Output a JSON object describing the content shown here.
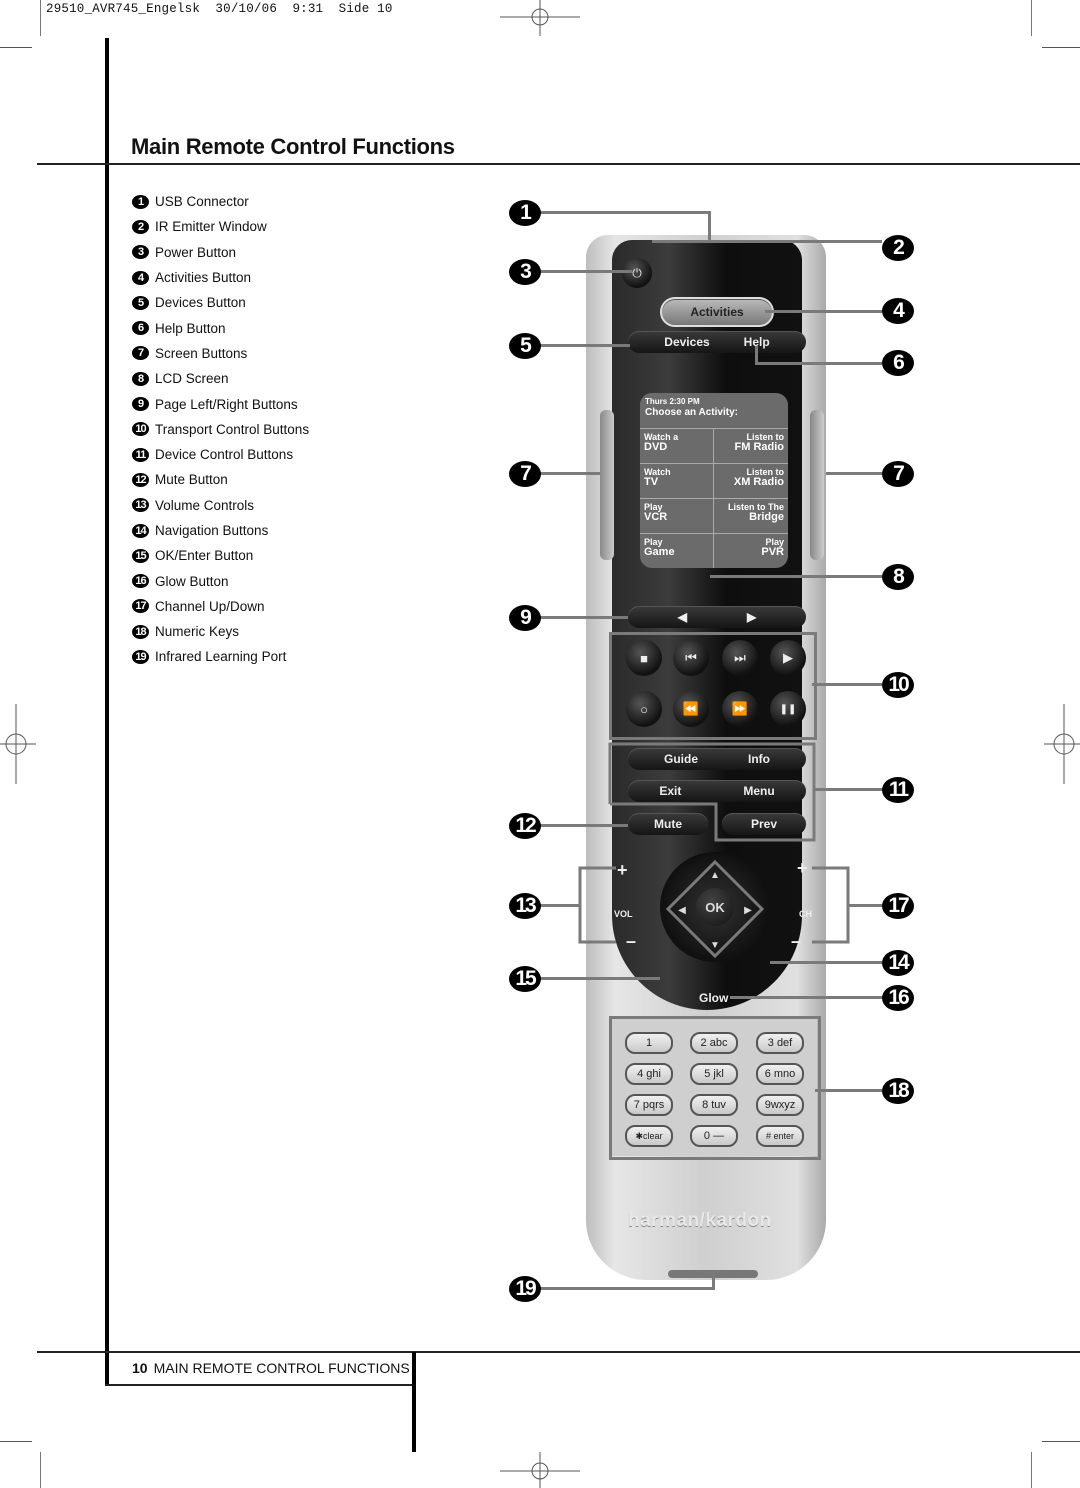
{
  "slug": "29510_AVR745_Engelsk  30/10/06  9:31  Side 10",
  "page_title": "Main Remote Control Functions",
  "legend": [
    {
      "num": "1",
      "label": "USB Connector"
    },
    {
      "num": "2",
      "label": "IR Emitter Window"
    },
    {
      "num": "3",
      "label": "Power Button"
    },
    {
      "num": "4",
      "label": "Activities Button"
    },
    {
      "num": "5",
      "label": "Devices Button"
    },
    {
      "num": "6",
      "label": "Help Button"
    },
    {
      "num": "7",
      "label": "Screen Buttons"
    },
    {
      "num": "8",
      "label": "LCD Screen"
    },
    {
      "num": "9",
      "label": "Page Left/Right Buttons"
    },
    {
      "num": "10",
      "label": "Transport Control Buttons"
    },
    {
      "num": "11",
      "label": "Device Control Buttons"
    },
    {
      "num": "12",
      "label": "Mute Button"
    },
    {
      "num": "13",
      "label": "Volume Controls"
    },
    {
      "num": "14",
      "label": "Navigation Buttons"
    },
    {
      "num": "15",
      "label": "OK/Enter Button"
    },
    {
      "num": "16",
      "label": "Glow Button"
    },
    {
      "num": "17",
      "label": "Channel Up/Down"
    },
    {
      "num": "18",
      "label": "Numeric Keys"
    },
    {
      "num": "19",
      "label": "Infrared Learning Port"
    }
  ],
  "callouts": {
    "c1": "1",
    "c2": "2",
    "c3": "3",
    "c4": "4",
    "c5": "5",
    "c6": "6",
    "c7a": "7",
    "c7b": "7",
    "c8": "8",
    "c9": "9",
    "c10": "10",
    "c11": "11",
    "c12": "12",
    "c13": "13",
    "c14": "14",
    "c15": "15",
    "c16": "16",
    "c17": "17",
    "c18": "18",
    "c19": "19"
  },
  "remote": {
    "power_icon": "power-icon",
    "activities": "Activities",
    "devices": "Devices",
    "help": "Help",
    "lcd": {
      "time": "Thurs 2:30 PM",
      "heading": "Choose an Activity:",
      "cells": [
        {
          "line1": "Watch a",
          "line2": "DVD"
        },
        {
          "line1": "Listen to",
          "line2": "FM Radio"
        },
        {
          "line1": "Watch",
          "line2": "TV"
        },
        {
          "line1": "Listen to",
          "line2": "XM Radio"
        },
        {
          "line1": "Play",
          "line2": "VCR"
        },
        {
          "line1": "Listen to The",
          "line2": "Bridge"
        },
        {
          "line1": "Play",
          "line2": "Game"
        },
        {
          "line1": "Play",
          "line2": "PVR"
        }
      ]
    },
    "page_left": "◀",
    "page_right": "▶",
    "transport": [
      "■",
      "⏮",
      "⏭",
      "▶",
      "○",
      "⏪",
      "⏩",
      "❚❚"
    ],
    "guide": "Guide",
    "info": "Info",
    "exit": "Exit",
    "menu": "Menu",
    "mute": "Mute",
    "prev": "Prev",
    "vol_label": "VOL",
    "ch_label": "CH",
    "plus": "+",
    "minus": "–",
    "ok": "OK",
    "glow": "Glow",
    "keys": [
      "1",
      "2 abc",
      "3 def",
      "4 ghi",
      "5 jkl",
      "6 mno",
      "7 pqrs",
      "8 tuv",
      "9wxyz",
      "✱clear",
      "0 —",
      "# enter"
    ],
    "brand": "harman/kardon"
  },
  "footer": {
    "page_number": "10",
    "section": "MAIN REMOTE CONTROL FUNCTIONS"
  }
}
